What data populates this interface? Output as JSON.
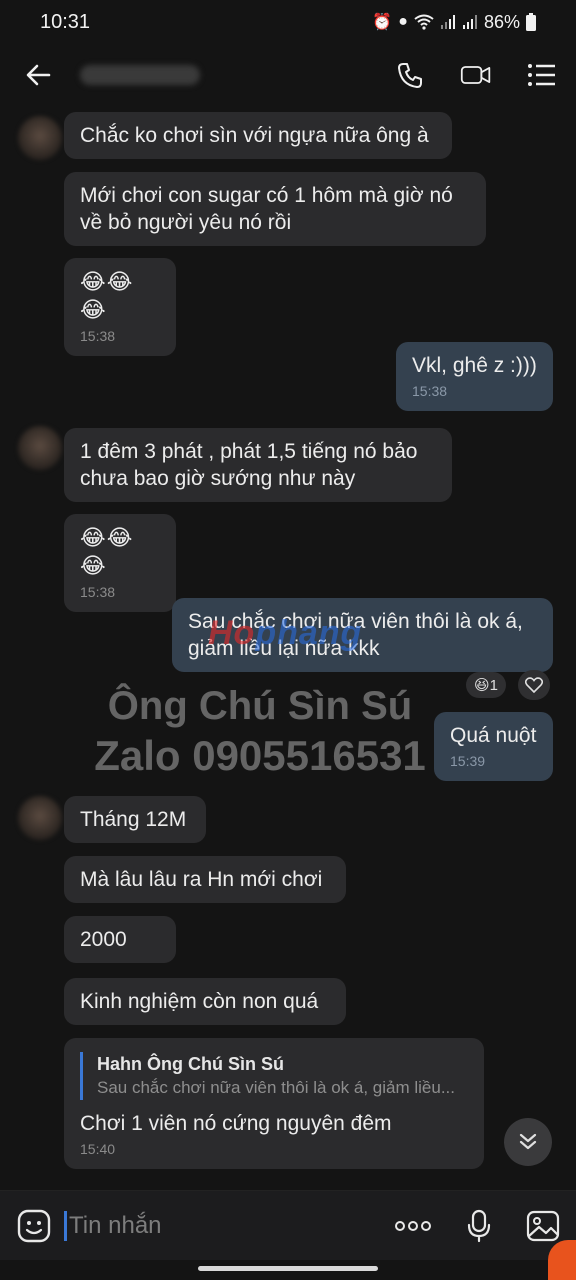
{
  "status_bar": {
    "time": "10:31",
    "battery": "86%",
    "icons": [
      "alarm-icon",
      "location-icon",
      "wifi-icon",
      "signal-icon",
      "signal-icon",
      "battery-icon"
    ]
  },
  "header": {
    "icons": [
      "back-arrow-icon",
      "phone-icon",
      "video-call-icon",
      "menu-list-icon"
    ]
  },
  "messages": [
    {
      "from": "them",
      "text": "Chắc ko chơi sìn với ngựa nữa ông à"
    },
    {
      "from": "them",
      "text": "Mới chơi con sugar có 1 hôm mà giờ nó về bỏ người yêu nó rồi"
    },
    {
      "from": "them",
      "text": "😂😂😂",
      "time": "15:38"
    },
    {
      "from": "me",
      "text": "Vkl, ghê z :)))",
      "time": "15:38"
    },
    {
      "from": "them",
      "text": "1 đêm 3 phát , phát 1,5 tiếng nó bảo chưa bao giờ sướng như này"
    },
    {
      "from": "them",
      "text": "😂😂😂",
      "time": "15:38"
    },
    {
      "from": "me",
      "text": "Sau chắc chơi nữa viên thôi là ok á, giảm liều lại nữa kkk"
    },
    {
      "from": "me",
      "text": "Quá nuột",
      "time": "15:39"
    },
    {
      "from": "them",
      "text": "Tháng 12M"
    },
    {
      "from": "them",
      "text": "Mà lâu lâu ra Hn mới chơi"
    },
    {
      "from": "them",
      "text": "2000"
    },
    {
      "from": "them",
      "text": "Kinh nghiệm còn non quá"
    },
    {
      "from": "them",
      "text": "Chơi 1 viên nó cứng nguyên đêm",
      "time": "15:40",
      "reply": {
        "name": "Hahn Ông Chú Sìn Sú",
        "text": "Sau chắc chơi nữa viên thôi là ok á, giảm liều..."
      }
    }
  ],
  "reaction": {
    "count": "1"
  },
  "watermark": {
    "line1": "Ông Chú Sìn Sú",
    "line2": "Zalo 0905516531",
    "logo_a": "Ho",
    "logo_b": "phang"
  },
  "input": {
    "placeholder": "Tin nhắn"
  },
  "colors": {
    "background": "#141414",
    "bubble_them": "#2b2b2d",
    "bubble_me": "#34414f",
    "accent": "#3a78d6"
  }
}
